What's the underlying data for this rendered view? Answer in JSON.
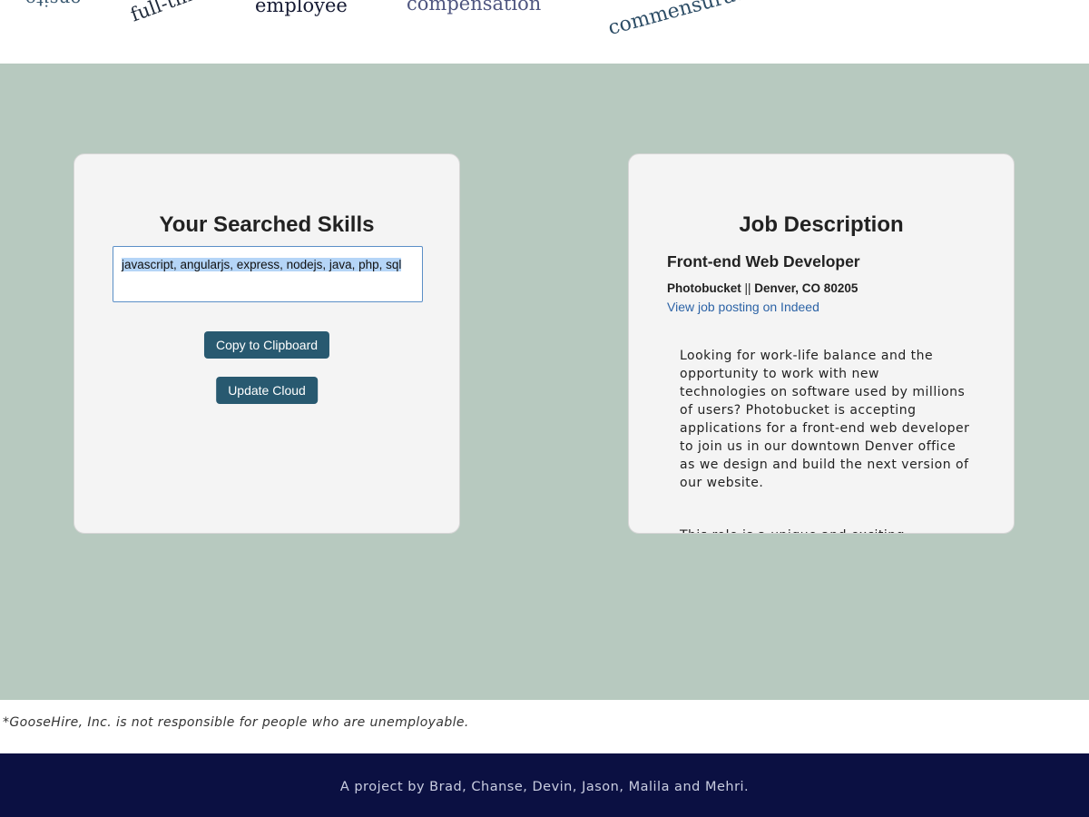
{
  "word_cloud": {
    "words": [
      "onsite",
      "full-time",
      "employee",
      "compensation",
      "commensurate"
    ]
  },
  "skills_panel": {
    "title": "Your Searched Skills",
    "skills_value": "javascript, angularjs, express, nodejs, java, php, sql",
    "copy_button": "Copy to Clipboard",
    "update_button": "Update Cloud"
  },
  "job_panel": {
    "title": "Job Description",
    "job_title": "Front-end Web Developer",
    "company": "Photobucket",
    "separator": " || ",
    "location": "Denver, CO 80205",
    "link_text": "View job posting on Indeed",
    "description": [
      "Looking for work-life balance and the opportunity to work with new technologies on software used by millions of users? Photobucket is accepting applications for a front-end web developer to join us in our downtown Denver office as we design and build the next version of our website.",
      "This role is a unique and exciting"
    ]
  },
  "disclaimer": "*GooseHire, Inc. is not responsible for people who are unemployable.",
  "footer": "A project by Brad, Chanse, Devin, Jason, Malila and Mehri.",
  "colors": {
    "background": "#b7c9bf",
    "button": "#285970",
    "footer": "#0b1042",
    "link": "#2c63a6"
  }
}
